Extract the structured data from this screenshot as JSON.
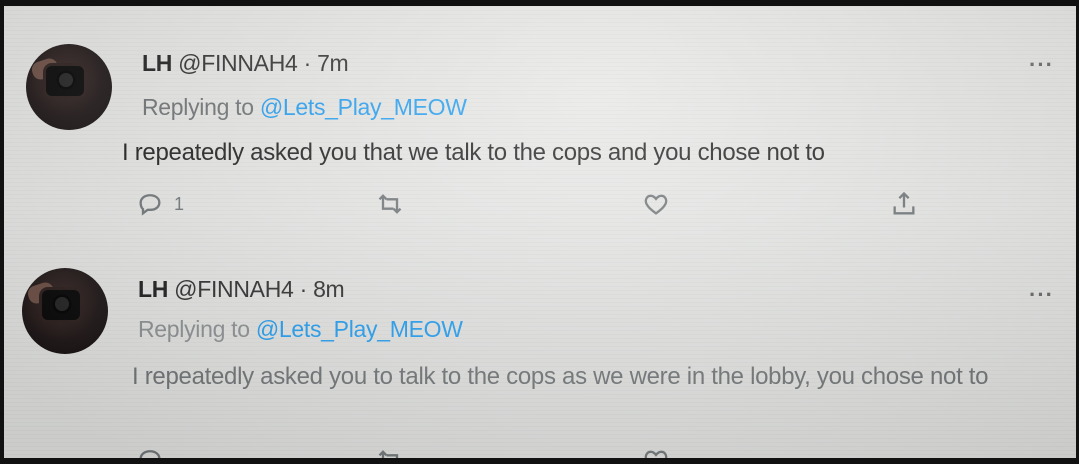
{
  "tweets": [
    {
      "name": "LH",
      "handle": "@FINNAH4",
      "sep": " · ",
      "time": "7m",
      "replying_prefix": "Replying to ",
      "replying_to": "@Lets_Play_MEOW",
      "text": "I repeatedly asked you that we talk to the cops and you chose not to",
      "more": "···",
      "reply_count": "1"
    },
    {
      "name": "LH",
      "handle": "@FINNAH4",
      "sep": " · ",
      "time": "8m",
      "replying_prefix": "Replying to ",
      "replying_to": "@Lets_Play_MEOW",
      "text": "I repeatedly asked you to talk to the cops as we were in the lobby, you chose not to",
      "more": "···"
    }
  ],
  "icons": {
    "reply": "reply-icon",
    "retweet": "retweet-icon",
    "like": "like-icon",
    "share": "share-icon",
    "more": "more-icon"
  },
  "colors": {
    "mention": "#1d9bf0",
    "icon": "#6f7477"
  }
}
